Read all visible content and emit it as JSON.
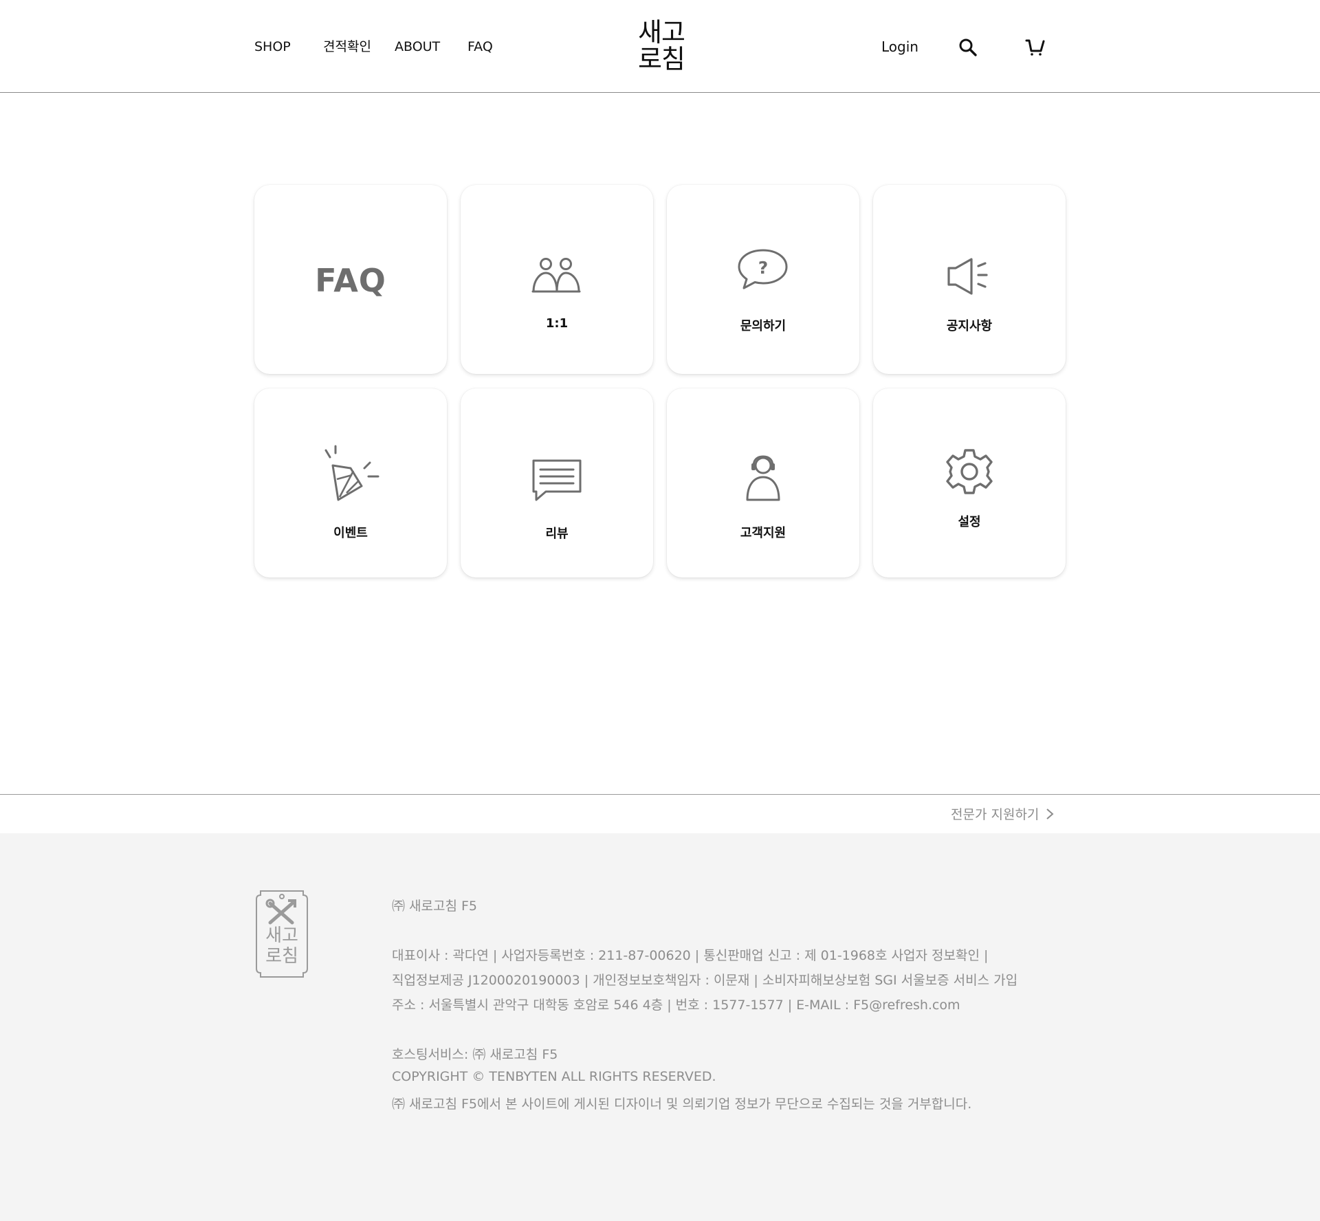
{
  "header": {
    "nav": [
      "SHOP",
      "견적확인",
      "ABOUT",
      "FAQ"
    ],
    "logo_line1": "새고",
    "logo_line2": "로침",
    "login_label": "Login"
  },
  "cards": [
    {
      "label": "",
      "icon": "faq-text-icon",
      "icon_text": "FAQ"
    },
    {
      "label": "1:1",
      "icon": "two-people-icon"
    },
    {
      "label": "문의하기",
      "icon": "question-bubble-icon"
    },
    {
      "label": "공지사항",
      "icon": "megaphone-icon"
    },
    {
      "label": "이벤트",
      "icon": "party-popper-icon"
    },
    {
      "label": "리뷰",
      "icon": "message-lines-icon"
    },
    {
      "label": "고객지원",
      "icon": "headset-person-icon"
    },
    {
      "label": "설정",
      "icon": "gear-icon"
    }
  ],
  "expert_link": "전문가 지원하기",
  "footer": {
    "badge_line1": "새고",
    "badge_line2": "로침",
    "company": "㈜ 새로고침 F5",
    "info1": "대표이사 : 곽다연 | 사업자등록번호 : 211-87-00620 | 통신판매업 신고 : 제 01-1968호 사업자 정보확인 |",
    "info2": "직업정보제공 J1200020190003 | 개인정보보호책임자 : 이문재 | 소비자피해보상보험 SGI 서울보증 서비스 가입",
    "info3": "주소 : 서울특별시 관악구 대학동 호암로 546 4층 | 번호 : 1577-1577 | E-MAIL : F5@refresh.com",
    "hosting": "호스팅서비스: ㈜ 새로고침 F5",
    "copyright": "COPYRIGHT © TENBYTEN ALL RIGHTS RESERVED.",
    "notice": "㈜ 새로고침 F5에서 본 사이트에 게시된 디자이너 및 의뢰기업 정보가 무단으로 수집되는 것을 거부합니다."
  },
  "colors": {
    "icon_gray": "#6e6e6e",
    "footer_bg": "#f4f4f4",
    "footer_text": "#8d8d8d"
  }
}
